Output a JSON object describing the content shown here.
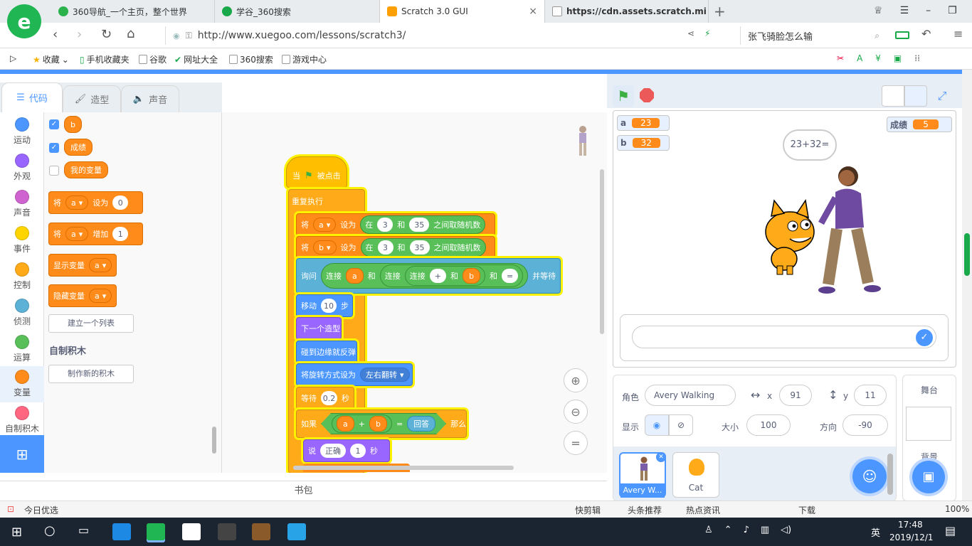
{
  "browser": {
    "tabs": [
      {
        "title": "360导航_一个主页，整个世界",
        "color": "#2bb24c"
      },
      {
        "title": "学谷_360搜索",
        "color": "#19a94a"
      },
      {
        "title": "Scratch 3.0 GUI",
        "color": "#ff9f00",
        "close": "×"
      },
      {
        "title": "https://cdn.assets.scratch.mi",
        "color": "#bbbbbb"
      }
    ],
    "new_tab": "+",
    "url": "http://www.xuegoo.com/lessons/scratch3/",
    "search_hint": "张飞骑脸怎么输",
    "bookmarks": [
      "收藏",
      "手机收藏夹",
      "谷歌",
      "网址大全",
      "360搜索",
      "游戏中心"
    ]
  },
  "scratch": {
    "tabs": {
      "code": "代码",
      "costumes": "造型",
      "sounds": "声音"
    },
    "categories": [
      {
        "label": "运动",
        "color": "#4c97ff"
      },
      {
        "label": "外观",
        "color": "#9966ff"
      },
      {
        "label": "声音",
        "color": "#cf63cf"
      },
      {
        "label": "事件",
        "color": "#ffd500"
      },
      {
        "label": "控制",
        "color": "#ffab19"
      },
      {
        "label": "侦测",
        "color": "#5cb1d6"
      },
      {
        "label": "运算",
        "color": "#59c059"
      },
      {
        "label": "变量",
        "color": "#ff8c1a"
      },
      {
        "label": "自制积木",
        "color": "#ff6680"
      }
    ],
    "palette": {
      "var_b": "b",
      "var_score": "成绩",
      "var_mine": "我的变量",
      "set_word": "将",
      "set_var": "a",
      "set_to": "设为",
      "set_val": "0",
      "change_word": "将",
      "change_var": "a",
      "change_by": "增加",
      "change_val": "1",
      "show_var": "显示变量",
      "show_var_name": "a",
      "hide_var": "隐藏变量",
      "hide_var_name": "a",
      "make_list": "建立一个列表",
      "my_blocks_heading": "自制积木",
      "make_block": "制作新的积木"
    },
    "script": {
      "hat_when": "当",
      "hat_clicked": "被点击",
      "forever": "重复执行",
      "set1": {
        "w": "将",
        "var": "a",
        "to": "设为",
        "in": "在",
        "from": "3",
        "and": "和",
        "to_val": "35",
        "pick": "之间取随机数"
      },
      "set2": {
        "w": "将",
        "var": "b",
        "to": "设为",
        "in": "在",
        "from": "3",
        "and": "和",
        "to_val": "35",
        "pick": "之间取随机数"
      },
      "ask": {
        "w": "询问",
        "join": "连接",
        "a": "a",
        "and": "和",
        "plus": "+",
        "b": "b",
        "eq": "=",
        "wait": "并等待"
      },
      "move": {
        "w": "移动",
        "val": "10",
        "steps": "步"
      },
      "next_costume": "下一个造型",
      "bounce": "碰到边缘就反弹",
      "rotation": {
        "w": "将旋转方式设为",
        "val": "左右翻转"
      },
      "wait": {
        "w": "等待",
        "val": "0.2",
        "sec": "秒"
      },
      "if": {
        "w": "如果",
        "a": "a",
        "plus": "+",
        "b": "b",
        "eq": "=",
        "answer": "回答",
        "then": "那么"
      },
      "say": {
        "w": "说",
        "msg": "正确",
        "val": "1",
        "sec": "秒"
      }
    },
    "backpack": "书包",
    "stage": {
      "monitors": [
        {
          "name": "a",
          "value": "23"
        },
        {
          "name": "b",
          "value": "32"
        },
        {
          "name": "成绩",
          "value": "5"
        }
      ],
      "speech": "23+32="
    },
    "sprite_info": {
      "sprite_label": "角色",
      "sprite_name": "Avery Walking",
      "x_label": "x",
      "x": "91",
      "y_label": "y",
      "y": "11",
      "show_label": "显示",
      "size_label": "大小",
      "size": "100",
      "dir_label": "方向",
      "dir": "-90"
    },
    "sprites": [
      {
        "name": "Avery W..."
      },
      {
        "name": "Cat"
      }
    ],
    "stage_panel": {
      "title": "舞台",
      "backdrop": "背景"
    }
  },
  "statusbar": {
    "left": "今日优选",
    "items": [
      "快剪辑",
      "头条推荐",
      "热点资讯",
      "下载"
    ],
    "zoom": "100%"
  },
  "taskbar": {
    "time": "17:48",
    "date": "2019/12/1",
    "ime": "英"
  }
}
